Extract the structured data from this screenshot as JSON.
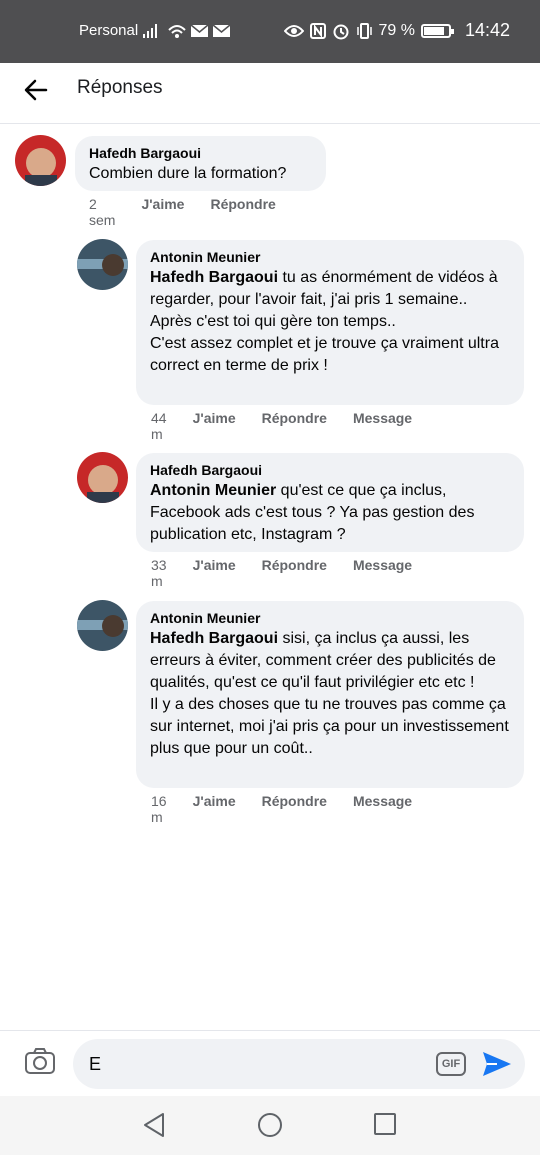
{
  "status": {
    "carrier": "Personal",
    "battery": "79 %",
    "time": "14:42",
    "battery_level": 0.79
  },
  "header": {
    "title": "Réponses"
  },
  "comments": [
    {
      "author": "Hafedh Bargaoui",
      "mention": "",
      "text": "Combien dure la formation?",
      "time": "2 sem",
      "like": "J'aime",
      "reply": "Répondre",
      "message": ""
    },
    {
      "author": "Antonin Meunier",
      "mention": "Hafedh Bargaoui",
      "text": " tu as énormément de vidéos à regarder, pour l'avoir fait, j'ai pris 1 semaine..\nAprès c'est toi qui gère ton temps..\nC'est assez complet et je trouve ça vraiment ultra correct en terme de prix !",
      "time": "44 m",
      "like": "J'aime",
      "reply": "Répondre",
      "message": "Message"
    },
    {
      "author": "Hafedh Bargaoui",
      "mention": "Antonin Meunier",
      "text": " qu'est ce que ça inclus, Facebook ads c'est tous ? Ya pas gestion des publication etc, Instagram ?",
      "time": "33 m",
      "like": "J'aime",
      "reply": "Répondre",
      "message": "Message"
    },
    {
      "author": "Antonin Meunier",
      "mention": "Hafedh Bargaoui",
      "text": " sisi, ça inclus ça aussi, les erreurs à éviter, comment créer des publicités de qualités, qu'est ce qu'il faut privilégier etc etc !\nIl y a des choses que tu ne trouves pas comme ça sur internet, moi j'ai pris ça pour un investissement plus que pour un coût..",
      "time": "16 m",
      "like": "J'aime",
      "reply": "Répondre",
      "message": "Message"
    }
  ],
  "composer": {
    "value": "E",
    "gif": "GIF"
  },
  "colors": {
    "accent": "#1877f2",
    "bubble": "#f0f2f5",
    "statusbar": "#4f4f51"
  }
}
